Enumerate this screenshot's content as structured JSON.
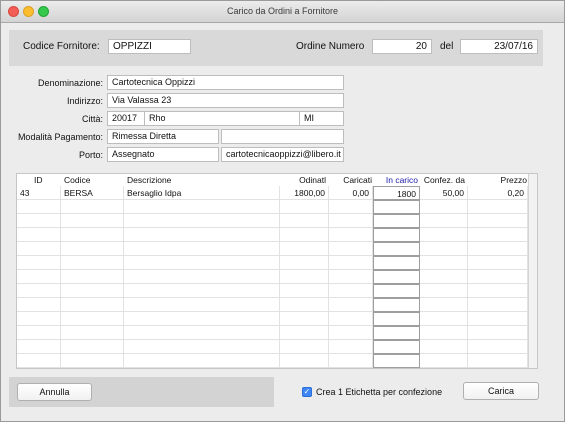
{
  "window": {
    "title": "Carico da Ordini a Fornitore"
  },
  "header": {
    "supplier_code_label": "Codice Fornitore:",
    "supplier_code_value": "OPPIZZI",
    "order_number_label": "Ordine Numero",
    "order_number_value": "20",
    "date_label": "del",
    "date_value": "23/07/16"
  },
  "supplier": {
    "name_label": "Denominazione:",
    "name_value": "Cartotecnica Oppizzi",
    "address_label": "Indirizzo:",
    "address_value": "Via Valassa 23",
    "city_label": "Città:",
    "zip_value": "20017",
    "city_value": "Rho",
    "province_value": "MI",
    "payment_label": "Modalità Pagamento:",
    "payment_value": "Rimessa Diretta",
    "payment_extra_value": "",
    "port_label": "Porto:",
    "port_value": "Assegnato",
    "email_value": "cartotecnicaoppizzi@libero.it"
  },
  "table": {
    "columns": [
      "ID",
      "Codice",
      "Descrizione",
      "Odinatl",
      "Caricati",
      "In carico",
      "Confez. da",
      "Prezzo"
    ],
    "rows": [
      [
        "43",
        "BERSA",
        "Bersaglio Idpa",
        "1800,00",
        "0,00",
        "1800",
        "50,00",
        "0,20"
      ]
    ],
    "empty_rows": 12
  },
  "footer": {
    "cancel_label": "Annulla",
    "checkbox_label": "Crea 1 Etichetta per confezione",
    "checkbox_checked": true,
    "load_label": "Carica"
  },
  "colors": {
    "in_carico_header": "#1a1aa8",
    "checkbox": "#3d86f5"
  }
}
